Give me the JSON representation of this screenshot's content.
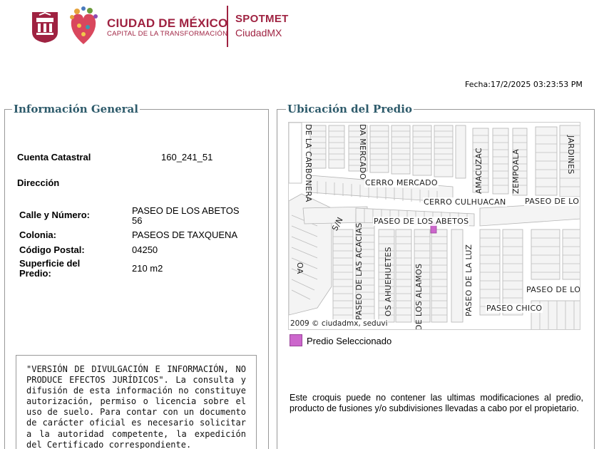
{
  "header": {
    "city_name": "CIUDAD DE MÉXICO",
    "city_slogan": "CAPITAL DE LA TRANSFORMACIÓN",
    "system_name": "SPOTMET",
    "system_sub": "CiudadMX",
    "brand_color": "#9f2241"
  },
  "fecha": {
    "label": "Fecha:",
    "value": "17/2/2025 03:23:53 PM"
  },
  "info_general": {
    "title": "Información General",
    "cuenta_label": "Cuenta Catastral",
    "cuenta_value": "160_241_51",
    "direccion_label": "Dirección",
    "calle_label": "Calle y Número:",
    "calle_value_1": "PASEO DE LOS ABETOS",
    "calle_value_2": "56",
    "colonia_label": "Colonia:",
    "colonia_value": "PASEOS DE TAXQUENA",
    "cp_label": "Código Postal:",
    "cp_value": "04250",
    "superficie_label_1": "Superficie del",
    "superficie_label_2": "Predio:",
    "superficie_value": "210 m2"
  },
  "disclaimer": {
    "text": "\"VERSIÓN DE DIVULGACIÓN E INFORMACIÓN, NO PRODUCE EFECTOS JURÍDICOS\". La consulta y difusión de esta información no constituye autorización, permiso o licencia sobre el uso de suelo. Para contar con un documento de carácter oficial es necesario solicitar a la autoridad competente, la expedición del Certificado correspondiente."
  },
  "ubicacion": {
    "title": "Ubicación del Predio",
    "map_copyright": "2009 © ciudadmx, seduvi",
    "streets": {
      "carbonera": "DE LA CARBONERA",
      "mercado_v": "DA MERCADO",
      "cerro_mercado": "CERRO MERCADO",
      "cerro_culhuacan": "CERRO CULHUACAN",
      "amacuzac": "AMACUZAC",
      "zempoala": "ZEMPOALA",
      "jardines": "JARDINES",
      "paseo_de_lo_1": "PASEO DE LO",
      "sin": "S/N",
      "abetos": "PASEO DE LOS ABETOS",
      "acacias": "PASEO DE LAS ACACIAS",
      "ahuehuetes": "OS AHUEHUETES",
      "alamos": "DE LOS ALAMOS",
      "la_luz": "PASEO DE LA LUZ",
      "paseo_de_lo_2": "PASEO DE LO",
      "paseo_chico": "PASEO CHICO",
      "oa": "OA"
    },
    "legend_label": "Predio Seleccionado",
    "highlight_color": "#cc66cc",
    "note": "Este croquis puede no contener las ultimas modificaciones al predio, producto de fusiones y/o subdivisiones llevadas a cabo por el propietario."
  }
}
